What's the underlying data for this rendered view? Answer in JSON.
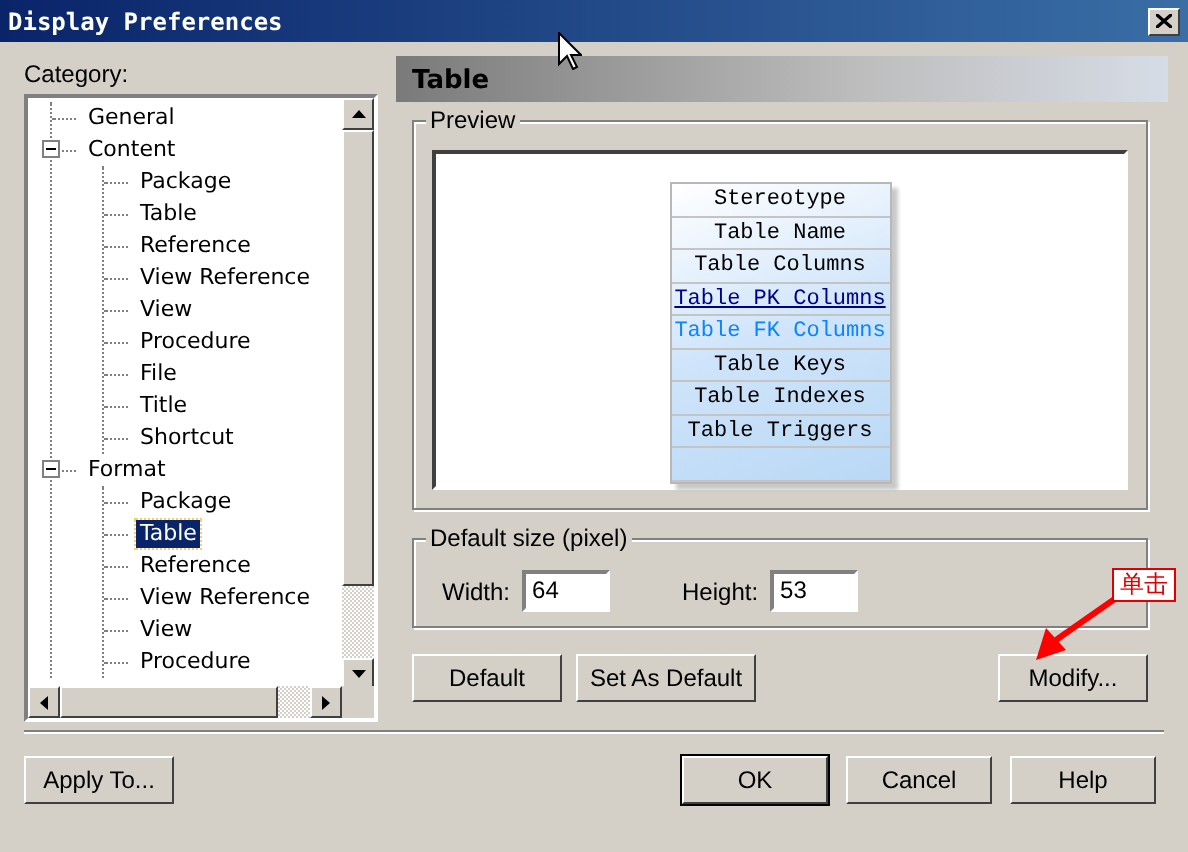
{
  "window": {
    "title": "Display Preferences"
  },
  "category_label": "Category:",
  "tree": [
    {
      "label": "General",
      "selected": false
    },
    {
      "label": "Content",
      "selected": false,
      "expanded": true,
      "children": [
        {
          "label": "Package",
          "selected": false
        },
        {
          "label": "Table",
          "selected": false
        },
        {
          "label": "Reference",
          "selected": false
        },
        {
          "label": "View Reference",
          "selected": false
        },
        {
          "label": "View",
          "selected": false
        },
        {
          "label": "Procedure",
          "selected": false
        },
        {
          "label": "File",
          "selected": false
        },
        {
          "label": "Title",
          "selected": false
        },
        {
          "label": "Shortcut",
          "selected": false
        }
      ]
    },
    {
      "label": "Format",
      "selected": false,
      "expanded": true,
      "children": [
        {
          "label": "Package",
          "selected": false
        },
        {
          "label": "Table",
          "selected": true
        },
        {
          "label": "Reference",
          "selected": false
        },
        {
          "label": "View Reference",
          "selected": false
        },
        {
          "label": "View",
          "selected": false
        },
        {
          "label": "Procedure",
          "selected": false
        }
      ]
    }
  ],
  "panel": {
    "title": "Table",
    "preview": {
      "label": "Preview",
      "rows": [
        {
          "text": "Stereotype",
          "kind": "plain"
        },
        {
          "text": "Table Name",
          "kind": "plain"
        },
        {
          "text": "Table Columns",
          "kind": "plain"
        },
        {
          "text": "Table PK Columns",
          "kind": "link"
        },
        {
          "text": "Table FK Columns",
          "kind": "accent"
        },
        {
          "text": "Table Keys",
          "kind": "plain"
        },
        {
          "text": "Table Indexes",
          "kind": "plain"
        },
        {
          "text": "Table Triggers",
          "kind": "plain"
        }
      ]
    },
    "default_size": {
      "label": "Default size (pixel)",
      "width": {
        "label": "Width:",
        "value": "64"
      },
      "height": {
        "label": "Height:",
        "value": "53"
      }
    },
    "buttons": [
      "Default",
      "Set As Default",
      "Modify..."
    ]
  },
  "apply_button": "Apply To...",
  "dialog_buttons": [
    {
      "label": "OK",
      "default": true
    },
    {
      "label": "Cancel",
      "default": false
    },
    {
      "label": "Help",
      "default": false
    }
  ],
  "annotation": {
    "text": "单击"
  }
}
